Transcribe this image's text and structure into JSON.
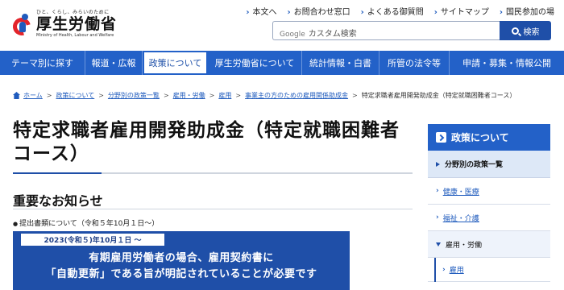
{
  "header": {
    "tagline": "ひと、くらし、みらいのために",
    "site_name": "厚生労働省",
    "site_name_en": "Ministry of Health, Labour and Welfare",
    "util_links": [
      "本文へ",
      "お問合わせ窓口",
      "よくある御質問",
      "サイトマップ",
      "国民参加の場"
    ],
    "search": {
      "google_label": "Google",
      "placeholder": "カスタム検索",
      "button_label": "検索"
    }
  },
  "nav": {
    "items": [
      "テーマ別に探す",
      "報道・広報",
      "政策について",
      "厚生労働省について",
      "統計情報・白書",
      "所管の法令等",
      "申請・募集・情報公開"
    ],
    "active_index": 2
  },
  "breadcrumb": {
    "links": [
      "ホーム",
      "政策について",
      "分野別の政策一覧",
      "雇用・労働",
      "雇用",
      "事業主の方のための雇用関係助成金"
    ],
    "current": "特定求職者雇用開発助成金（特定就職困難者コース）"
  },
  "main": {
    "title_line1": "特定求職者雇用開発助成金（特定就職困難者",
    "title_line2": "コース）",
    "section_heading": "重要なお知らせ",
    "notice_line": "提出書類について（令和５年10月１日～）",
    "banner": {
      "date_label": "2023(令和５)年10月１日 ～",
      "line1": "有期雇用労働者の場合、雇用契約書に",
      "line2": "「自動更新」である旨が明記されていることが必要です"
    }
  },
  "sidebar": {
    "heading": "政策について",
    "subheading": "分野別の政策一覧",
    "items": [
      "健康・医療",
      "福祉・介護",
      "雇用・労働",
      "雇用"
    ]
  },
  "colors": {
    "primary": "#2361c8",
    "dark_blue": "#1f4fa8",
    "brand_red": "#e3242b"
  }
}
